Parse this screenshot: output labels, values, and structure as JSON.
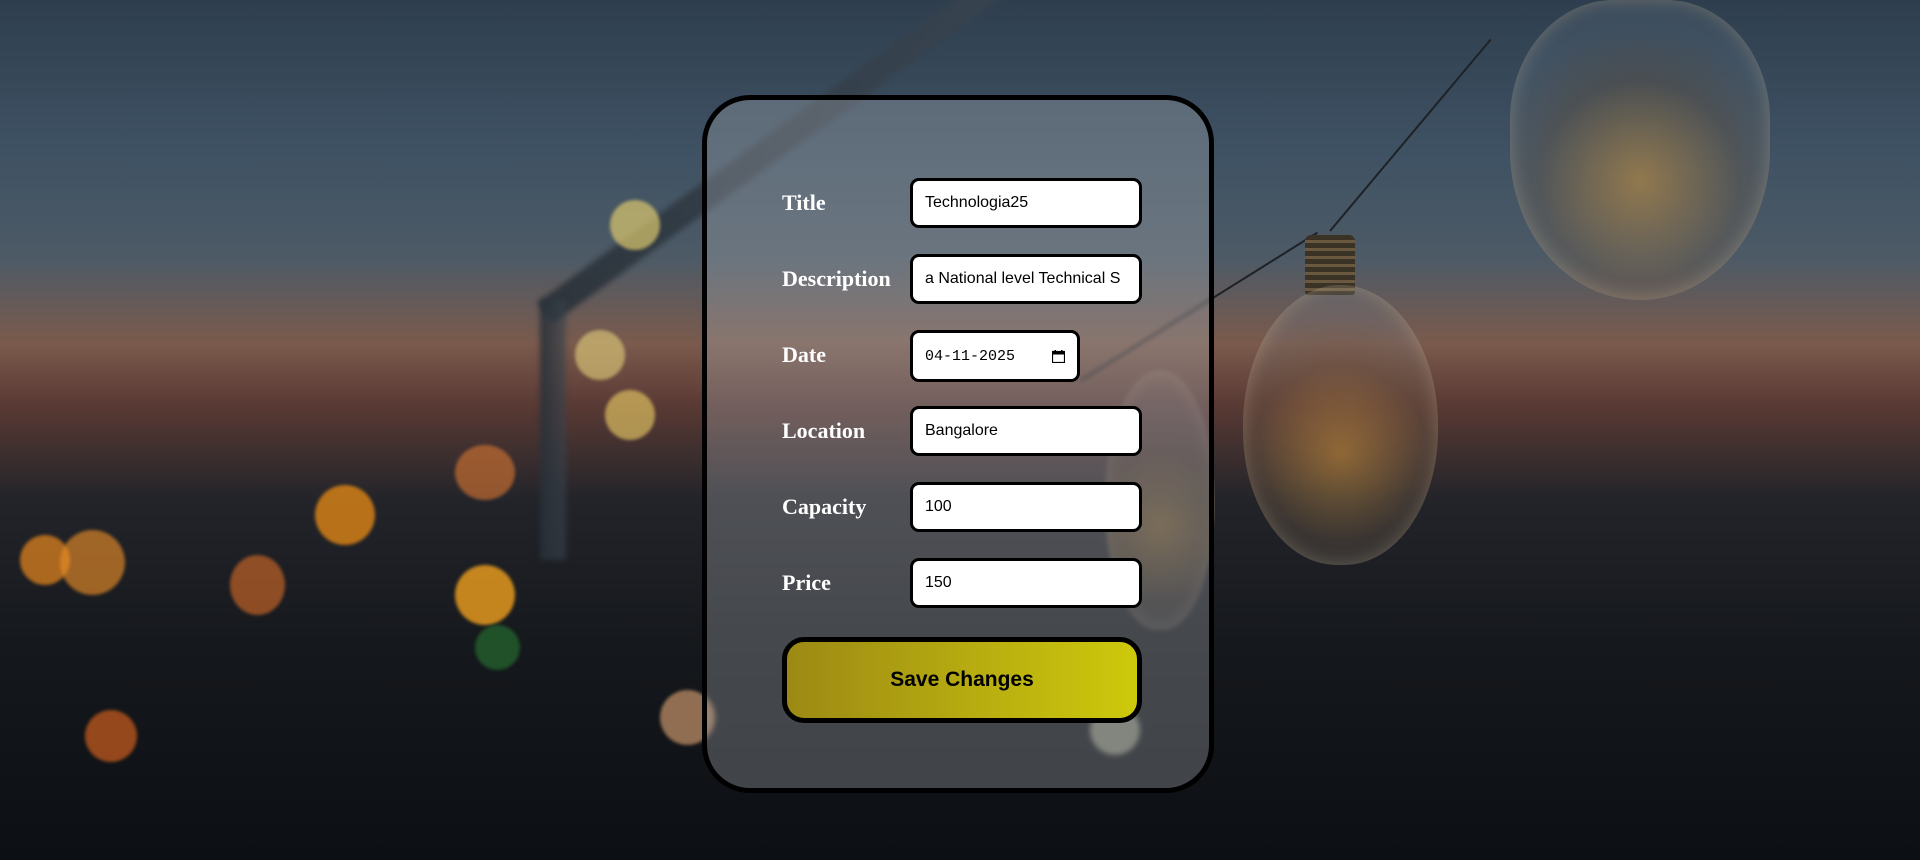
{
  "form": {
    "title_label": "Title",
    "title_value": "Technologia25",
    "description_label": "Description",
    "description_value": "a National level Technical S",
    "date_label": "Date",
    "date_value": "04-11-2025",
    "location_label": "Location",
    "location_value": "Bangalore",
    "capacity_label": "Capacity",
    "capacity_value": "100",
    "price_label": "Price",
    "price_value": "150",
    "save_label": "Save Changes"
  },
  "colors": {
    "button_gradient_start": "#9c8914",
    "button_gradient_end": "#cdc90c",
    "card_border": "#000000",
    "label_text": "#ffffff"
  },
  "icons": {
    "date_picker": "calendar-icon"
  }
}
